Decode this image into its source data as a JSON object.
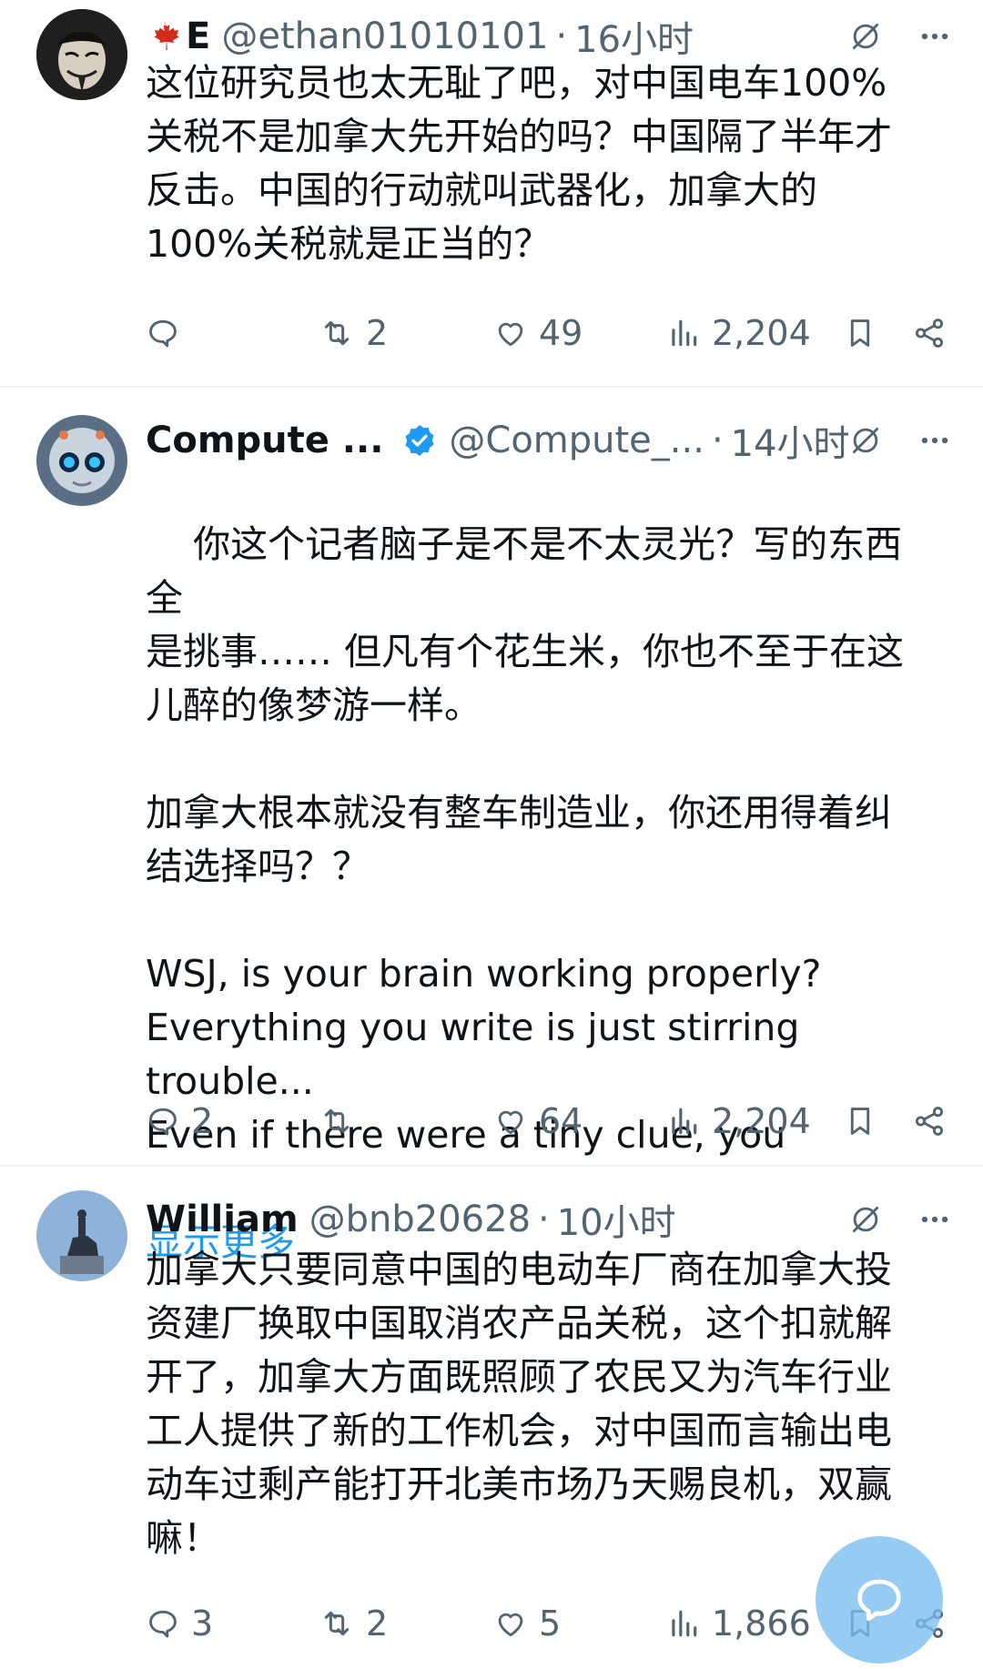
{
  "colors": {
    "accent": "#1d9bf0",
    "text": "#0f1419",
    "muted": "#536471",
    "divider": "#eff3f4",
    "canada_red": "#d52b1e"
  },
  "tweets": [
    {
      "flag_icon": "maple-leaf-icon",
      "display_name": "E",
      "handle": "@ethan01010101",
      "separator": "·",
      "time": "16小时",
      "text": "这位研究员也太无耻了吧，对中国电车100%\n关税不是加拿大先开始的吗？中国隔了半年才\n反击。中国的行动就叫武器化，加拿大的\n100%关税就是正当的？",
      "show_more": "",
      "replies": "",
      "retweets": "2",
      "likes": "49",
      "views": "2,204"
    },
    {
      "display_name": "Compute ...",
      "verified_icon": "verified-badge-icon",
      "handle": "@Compute_...",
      "separator": "·",
      "time": "14小时",
      "text": "你这个记者脑子是不是不太灵光？写的东西全\n是挑事…… 但凡有个花生米，你也不至于在这\n儿醉的像梦游一样。\n\n加拿大根本就没有整车制造业，你还用得着纠\n结选择吗？？\n\nWSJ, is your brain working properly?\nEverything you write is just stirring trouble...\nEven if there were a tiny clue, you",
      "show_more": "显示更多",
      "replies": "2",
      "retweets": "",
      "likes": "64",
      "views": "2,204"
    },
    {
      "display_name": "William",
      "handle": "@bnb20628",
      "separator": "·",
      "time": "10小时",
      "text": "加拿大只要同意中国的电动车厂商在加拿大投\n资建厂换取中国取消农产品关税，这个扣就解\n开了，加拿大方面既照顾了农民又为汽车行业\n工人提供了新的工作机会，对中国而言输出电\n动车过剩产能打开北美市场乃天赐良机，双赢\n嘛！",
      "show_more": "",
      "replies": "3",
      "retweets": "2",
      "likes": "5",
      "views": "1,866"
    }
  ],
  "fab": {
    "icon": "compose-message-icon"
  }
}
